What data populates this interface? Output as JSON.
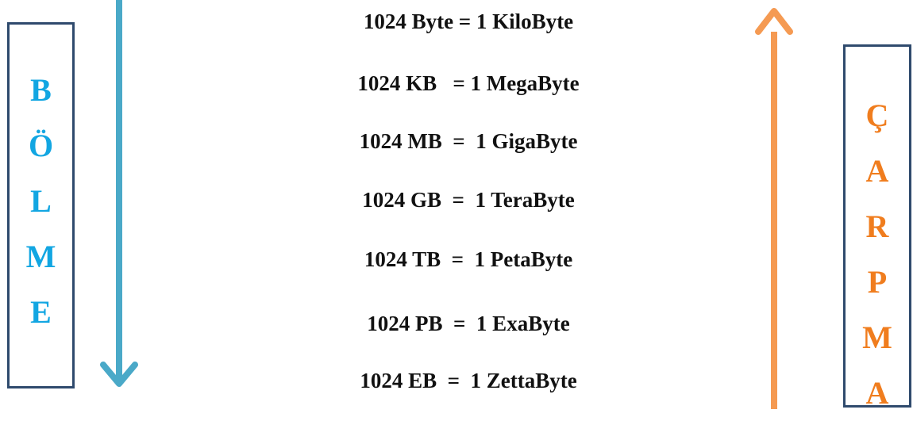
{
  "left_label": {
    "letters": [
      "B",
      "Ö",
      "L",
      "M",
      "E"
    ],
    "color": "#12a6e2"
  },
  "right_label": {
    "letters": [
      "Ç",
      "A",
      "R",
      "P",
      "M",
      "A"
    ],
    "color": "#f07d1e"
  },
  "conversions": [
    "1024 Byte = 1 KiloByte",
    "1024 KB   = 1 MegaByte",
    "1024 MB  =  1 GigaByte",
    "1024 GB  =  1 TeraByte",
    "1024 TB  =  1 PetaByte",
    "1024 PB  =  1 ExaByte",
    "1024 EB  =  1 ZettaByte"
  ],
  "arrows": {
    "down_color": "#4aa9c8",
    "up_color": "#f59a52"
  }
}
